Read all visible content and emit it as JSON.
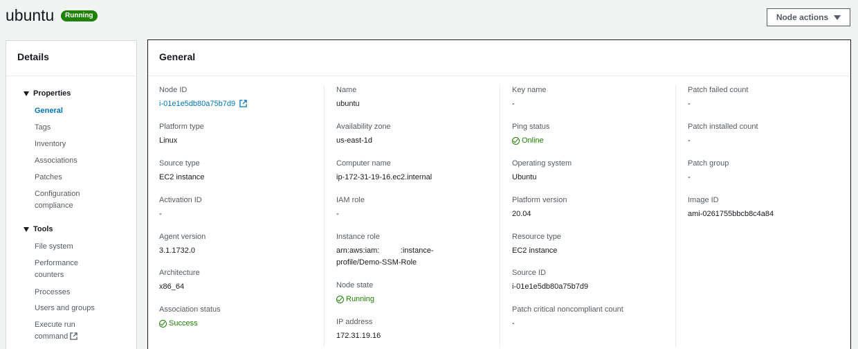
{
  "header": {
    "title": "ubuntu",
    "status": "Running",
    "actions_label": "Node actions"
  },
  "sidebar": {
    "title": "Details",
    "sections": [
      {
        "label": "Properties",
        "items": [
          "General",
          "Tags",
          "Inventory",
          "Associations",
          "Patches",
          "Configuration compliance"
        ]
      },
      {
        "label": "Tools",
        "items": [
          "File system",
          "Performance counters",
          "Processes",
          "Users and groups",
          "Execute run command"
        ]
      }
    ],
    "active_item": "General"
  },
  "main": {
    "title": "General",
    "columns": [
      [
        {
          "label": "Node ID",
          "value": "i-01e1e5db80a75b7d9"
        },
        {
          "label": "Platform type",
          "value": "Linux"
        },
        {
          "label": "Source type",
          "value": "EC2 instance"
        },
        {
          "label": "Activation ID",
          "value": "-"
        },
        {
          "label": "Agent version",
          "value": "3.1.1732.0"
        },
        {
          "label": "Architecture",
          "value": "x86_64"
        },
        {
          "label": "Association status",
          "value": "Success"
        }
      ],
      [
        {
          "label": "Name",
          "value": "ubuntu"
        },
        {
          "label": "Availability zone",
          "value": "us-east-1d"
        },
        {
          "label": "Computer name",
          "value": "ip-172-31-19-16.ec2.internal"
        },
        {
          "label": "IAM role",
          "value": "-"
        },
        {
          "label": "Instance role",
          "value_line1": "arn:aws:iam:          :instance-",
          "value_line2": "profile/Demo-SSM-Role"
        },
        {
          "label": "Node state",
          "value": "Running"
        },
        {
          "label": "IP address",
          "value": "172.31.19.16"
        }
      ],
      [
        {
          "label": "Key name",
          "value": "-"
        },
        {
          "label": "Ping status",
          "value": "Online"
        },
        {
          "label": "Operating system",
          "value": "Ubuntu"
        },
        {
          "label": "Platform version",
          "value": "20.04"
        },
        {
          "label": "Resource type",
          "value": "EC2 instance"
        },
        {
          "label": "Source ID",
          "value": "i-01e1e5db80a75b7d9"
        },
        {
          "label": "Patch critical noncompliant count",
          "value": "-"
        }
      ],
      [
        {
          "label": "Patch failed count",
          "value": "-"
        },
        {
          "label": "Patch installed count",
          "value": "-"
        },
        {
          "label": "Patch group",
          "value": "-"
        },
        {
          "label": "Image ID",
          "value": "ami-0261755bbcb8c4a84"
        }
      ]
    ]
  },
  "colors": {
    "link": "#0073bb",
    "success": "#1d8102",
    "text": "#16191f",
    "muted": "#545b64"
  }
}
